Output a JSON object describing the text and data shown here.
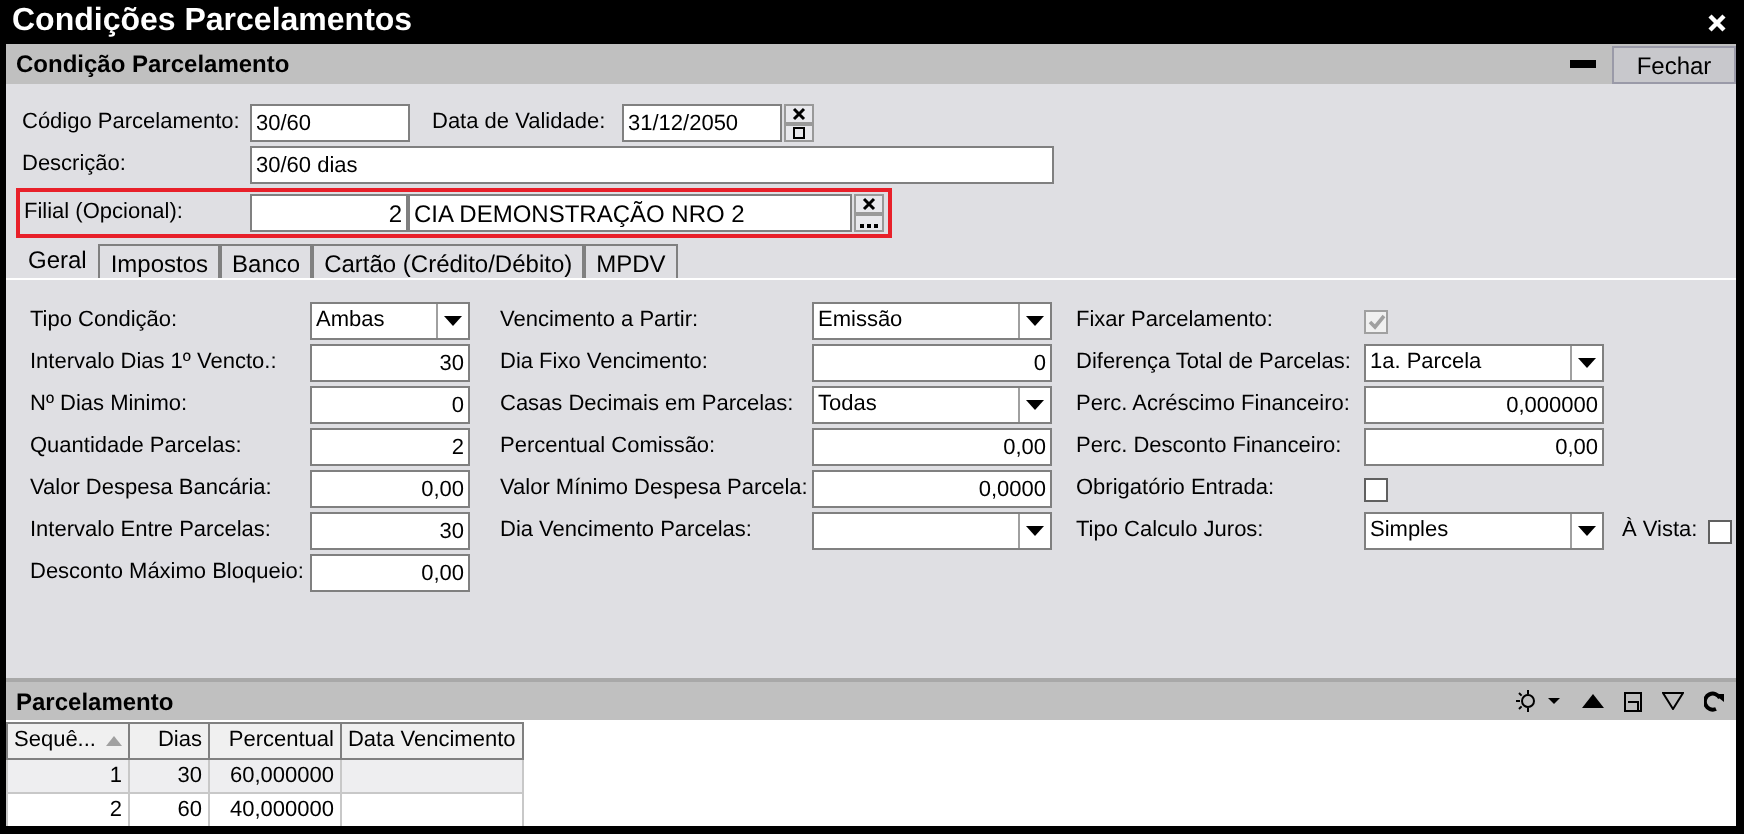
{
  "window": {
    "title": "Condições Parcelamentos"
  },
  "panel": {
    "title": "Condição Parcelamento",
    "close_button": "Fechar"
  },
  "header_fields": {
    "codigo": {
      "label": "Código Parcelamento:",
      "value": "30/60"
    },
    "validade": {
      "label": "Data de Validade:",
      "value": "31/12/2050"
    },
    "descricao": {
      "label": "Descrição:",
      "value": "30/60 dias"
    },
    "filial": {
      "label": "Filial (Opcional):",
      "code": "2",
      "name": "CIA DEMONSTRAÇÃO NRO 2",
      "highlighted": true
    }
  },
  "tabs": [
    {
      "label": "Geral",
      "selected": true
    },
    {
      "label": "Impostos",
      "selected": false
    },
    {
      "label": "Banco",
      "selected": false
    },
    {
      "label": "Cartão (Crédito/Débito)",
      "selected": false
    },
    {
      "label": "MPDV",
      "selected": false
    }
  ],
  "form_columns": [
    [
      {
        "kind": "select",
        "label": "Tipo Condição:",
        "value": "Ambas"
      },
      {
        "kind": "number",
        "label": "Intervalo Dias 1º Vencto.:",
        "value": "30"
      },
      {
        "kind": "number",
        "label": "Nº Dias Minimo:",
        "value": "0"
      },
      {
        "kind": "number",
        "label": "Quantidade Parcelas:",
        "value": "2"
      },
      {
        "kind": "number",
        "label": "Valor Despesa Bancária:",
        "value": "0,00"
      },
      {
        "kind": "number",
        "label": "Intervalo Entre Parcelas:",
        "value": "30"
      },
      {
        "kind": "number",
        "label": "Desconto Máximo Bloqueio:",
        "value": "0,00"
      }
    ],
    [
      {
        "kind": "select",
        "label": "Vencimento a Partir:",
        "value": "Emissão"
      },
      {
        "kind": "number",
        "label": "Dia Fixo Vencimento:",
        "value": "0"
      },
      {
        "kind": "select",
        "label": "Casas Decimais em Parcelas:",
        "value": "Todas"
      },
      {
        "kind": "number",
        "label": "Percentual Comissão:",
        "value": "0,00"
      },
      {
        "kind": "number",
        "label": "Valor Mínimo Despesa Parcela:",
        "value": "0,0000"
      },
      {
        "kind": "select",
        "label": "Dia Vencimento Parcelas:"
      }
    ],
    [
      {
        "kind": "checkbox",
        "label": "Fixar Parcelamento:",
        "checked": true,
        "disabled": true
      },
      {
        "kind": "select",
        "label": "Diferença Total de Parcelas:",
        "value": "1a. Parcela"
      },
      {
        "kind": "number",
        "label": "Perc. Acréscimo Financeiro:",
        "value": "0,000000"
      },
      {
        "kind": "number",
        "label": "Perc. Desconto Financeiro:",
        "value": "0,00"
      },
      {
        "kind": "checkbox",
        "label": "Obrigatório Entrada:",
        "checked": false,
        "disabled": false
      },
      {
        "kind": "select",
        "label": "Tipo Calculo Juros:",
        "value": "Simples",
        "extra": {
          "label": "À Vista:",
          "checked": false,
          "disabled": false
        }
      }
    ]
  ],
  "grid": {
    "title": "Parcelamento",
    "columns": [
      {
        "label": "Sequê...",
        "sorted_ascending": true
      },
      {
        "label": "Dias"
      },
      {
        "label": "Percentual"
      },
      {
        "label": "Data Vencimento"
      }
    ],
    "rows": [
      {
        "cells": [
          "1",
          "30",
          "60,000000",
          ""
        ],
        "selected": true
      },
      {
        "cells": [
          "2",
          "60",
          "40,000000",
          ""
        ],
        "selected": false
      }
    ]
  }
}
